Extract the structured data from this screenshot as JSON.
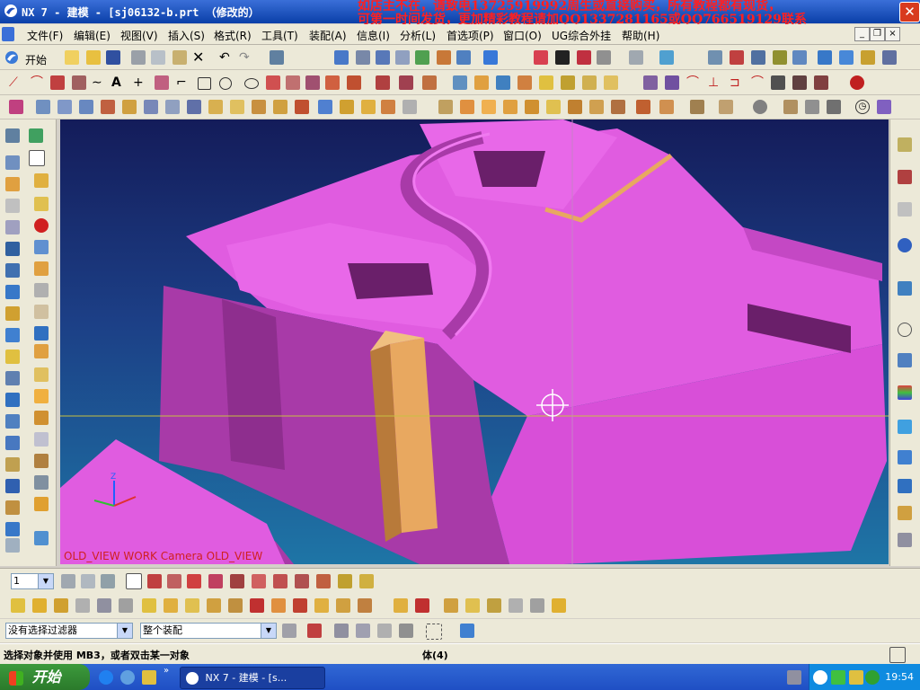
{
  "window": {
    "title": "NX 7 - 建模 - [sj06132-b.prt （修改的）",
    "icon": "nx-logo-icon",
    "close_symbol": "✕"
  },
  "overlay": {
    "ad_line1": "如店主不在，请致电13725919992周生或直接购买，所有教程都有现货，",
    "ad_line2": "可第一时间发货，更加精彩教程请加QQ1337281165或QQ766519129联系"
  },
  "menu": {
    "items": [
      "文件(F)",
      "编辑(E)",
      "视图(V)",
      "插入(S)",
      "格式(R)",
      "工具(T)",
      "装配(A)",
      "信息(I)",
      "分析(L)",
      "首选项(P)",
      "窗口(O)",
      "UG综合外挂",
      "帮助(H)"
    ]
  },
  "toolbar": {
    "start_label": "开始"
  },
  "viewport": {
    "view_label": "OLD_VIEW WORK Camera OLD_VIEW",
    "colors": {
      "part": "#e05ce0",
      "part_dark": "#a83aa8",
      "pillar": "#e8a860",
      "pillar_dark": "#b87a3a"
    }
  },
  "bottom": {
    "layer_value": "1",
    "filter_value": "没有选择过滤器",
    "scope_value": "整个装配"
  },
  "status": {
    "prompt": "选择对象并使用 MB3，或者双击某一对象",
    "selection": "体(4)"
  },
  "taskbar": {
    "start": "开始",
    "app": "NX 7 - 建模 - [s...",
    "clock": "19:54"
  }
}
